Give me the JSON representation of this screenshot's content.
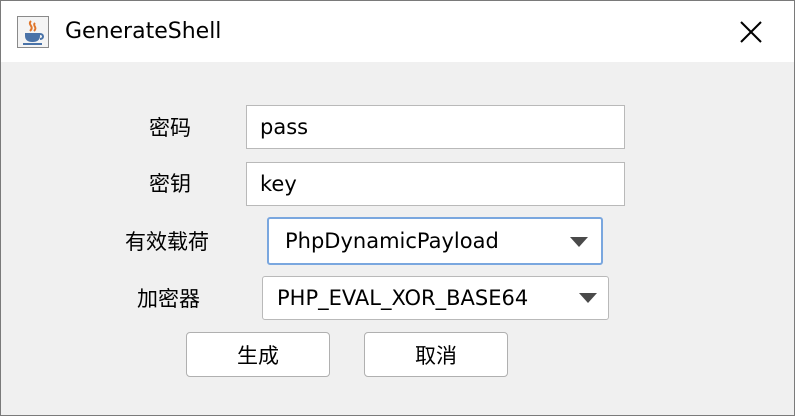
{
  "window": {
    "title": "GenerateShell",
    "app_icon": "java-coffee-icon",
    "close_icon": "close-icon"
  },
  "form": {
    "password": {
      "label": "密码",
      "value": "pass"
    },
    "key": {
      "label": "密钥",
      "value": "key"
    },
    "payload": {
      "label": "有效载荷",
      "selected": "PhpDynamicPayload",
      "focused": true
    },
    "encryptor": {
      "label": "加密器",
      "selected": "PHP_EVAL_XOR_BASE64"
    }
  },
  "buttons": {
    "generate": "生成",
    "cancel": "取消"
  },
  "colors": {
    "window_bg": "#f0f0f0",
    "titlebar_bg": "#ffffff",
    "focus_border": "#7aa7df",
    "field_border": "#b9b9b9"
  }
}
